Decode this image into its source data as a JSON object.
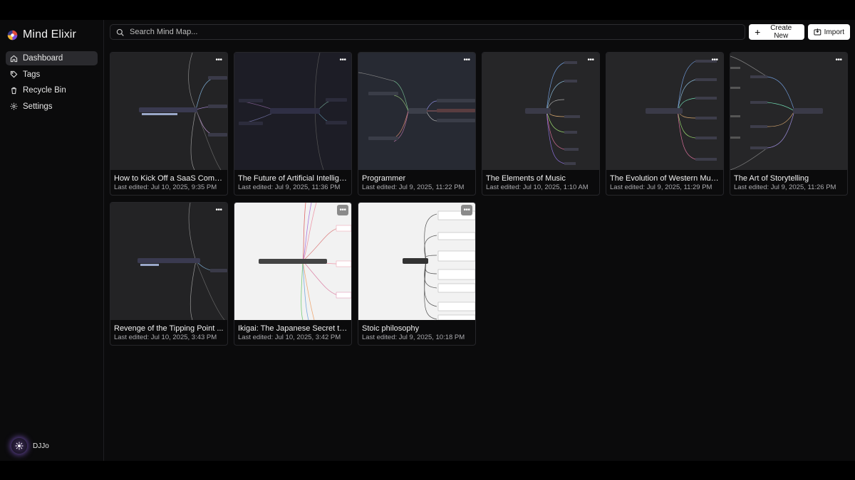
{
  "app": {
    "name": "Mind Elixir"
  },
  "sidebar": {
    "items": [
      {
        "label": "Dashboard",
        "icon": "home-icon",
        "active": true
      },
      {
        "label": "Tags",
        "icon": "tag-icon",
        "active": false
      },
      {
        "label": "Recycle Bin",
        "icon": "trash-icon",
        "active": false
      },
      {
        "label": "Settings",
        "icon": "gear-icon",
        "active": false
      }
    ],
    "user": {
      "name": "DJJo"
    }
  },
  "search": {
    "placeholder": "Search Mind Map..."
  },
  "toolbar": {
    "create_label": "Create New",
    "import_label": "Import"
  },
  "cards": [
    {
      "title": "How to Kick Off a SaaS Compa...",
      "date": "Last edited: Jul 10, 2025, 9:35 PM",
      "theme": "dark"
    },
    {
      "title": "The Future of Artificial Intellige...",
      "date": "Last edited: Jul 9, 2025, 11:36 PM",
      "theme": "dark"
    },
    {
      "title": "Programmer",
      "date": "Last edited: Jul 9, 2025, 11:22 PM",
      "theme": "dark"
    },
    {
      "title": "The Elements of Music",
      "date": "Last edited: Jul 10, 2025, 1:10 AM",
      "theme": "dark"
    },
    {
      "title": "The Evolution of Western Music",
      "date": "Last edited: Jul 9, 2025, 11:29 PM",
      "theme": "dark"
    },
    {
      "title": "The Art of Storytelling",
      "date": "Last edited: Jul 9, 2025, 11:26 PM",
      "theme": "dark"
    },
    {
      "title": "Revenge of the Tipping Point ...",
      "date": "Last edited: Jul 10, 2025, 3:43 PM",
      "theme": "dark"
    },
    {
      "title": "Ikigai: The Japanese Secret to ...",
      "date": "Last edited: Jul 10, 2025, 3:42 PM",
      "theme": "light"
    },
    {
      "title": "Stoic philosophy",
      "date": "Last edited: Jul 9, 2025, 10:18 PM",
      "theme": "light"
    }
  ],
  "more_label": "•••"
}
